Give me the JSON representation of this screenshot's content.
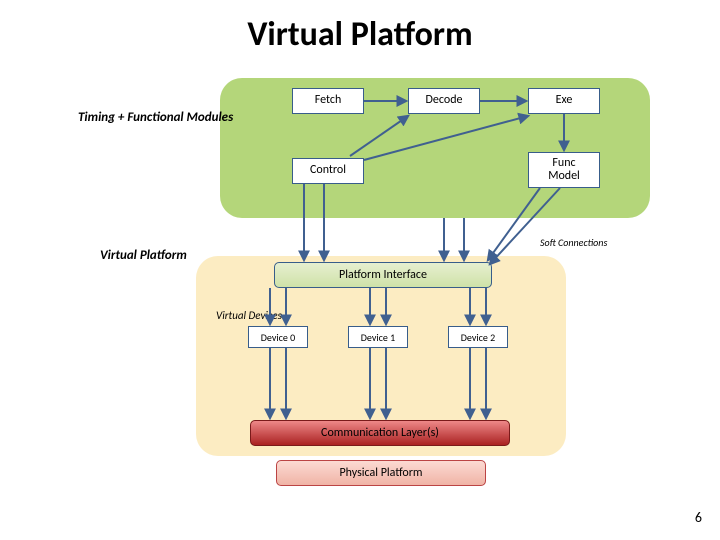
{
  "title": "Virtual Platform",
  "labels": {
    "timing_modules": "Timing + Functional Modules",
    "virtual_platform": "Virtual Platform",
    "soft_connections": "Soft Connections",
    "virtual_devices": "Virtual Devices"
  },
  "stages": {
    "fetch": "Fetch",
    "decode": "Decode",
    "exe": "Exe",
    "control": "Control",
    "func_model": "Func\nModel"
  },
  "platform_interface": "Platform Interface",
  "devices": [
    "Device 0",
    "Device 1",
    "Device 2"
  ],
  "comm_layer": "Communication Layer(s)",
  "physical": "Physical Platform",
  "page": "6",
  "colors": {
    "green_panel": "#b4d67a",
    "yellow_panel": "#fcecc2",
    "box_border": "#385d8a"
  }
}
